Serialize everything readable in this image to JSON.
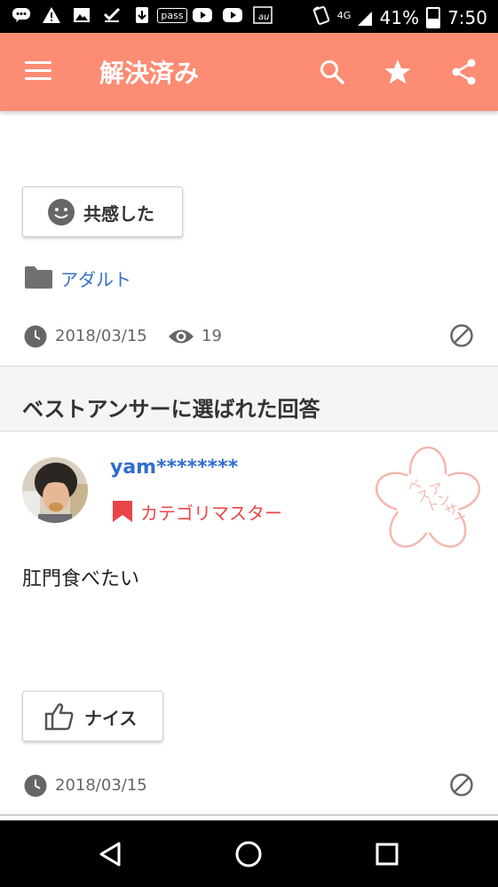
{
  "status_bar": {
    "pass_label": "pass",
    "network": "4G",
    "battery": "41%",
    "battery_level": 0.41,
    "time": "7:50",
    "icons": [
      "chat-icon",
      "warning-icon",
      "image-icon",
      "check-icon",
      "download-icon",
      "pass-icon",
      "youtube-icon",
      "youtube-icon",
      "au-icon",
      "nfc-icon",
      "signal-icon",
      "battery-icon"
    ]
  },
  "app_bar": {
    "title": "解決済み",
    "icons": [
      "menu-icon",
      "search-icon",
      "star-icon",
      "share-icon"
    ]
  },
  "question": {
    "empathy_button": "共感した",
    "category": "アダルト",
    "date": "2018/03/15",
    "views": "19"
  },
  "best_answer": {
    "section_title": "ベストアンサーに選ばれた回答",
    "username": "yam********",
    "badge": "カテゴリマスター",
    "stamp_text": "ベストアンサー",
    "answer": "肛門食べたい",
    "nice_button": "ナイス",
    "date": "2018/03/15"
  },
  "colors": {
    "app_bar": "#fc8c73",
    "link": "#3370c9",
    "username": "#2f6ccf",
    "badge": "#e8454a",
    "stamp": "#f5b7b0"
  },
  "nav_bar": {
    "buttons": [
      "back-icon",
      "home-icon",
      "recents-icon"
    ]
  }
}
